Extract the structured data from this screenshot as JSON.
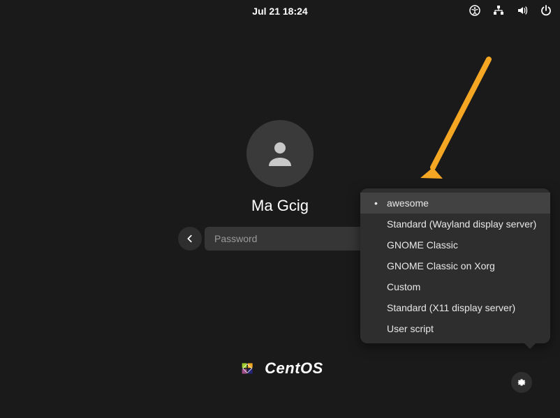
{
  "topbar": {
    "datetime": "Jul 21  18:24"
  },
  "user": {
    "name": "Ma Gcig"
  },
  "password": {
    "placeholder": "Password"
  },
  "branding": {
    "name": "CentOS"
  },
  "session_menu": {
    "items": [
      {
        "label": "awesome",
        "selected": true,
        "highlighted": true
      },
      {
        "label": "Standard (Wayland display server)",
        "selected": false,
        "highlighted": false
      },
      {
        "label": "GNOME Classic",
        "selected": false,
        "highlighted": false
      },
      {
        "label": "GNOME Classic on Xorg",
        "selected": false,
        "highlighted": false
      },
      {
        "label": "Custom",
        "selected": false,
        "highlighted": false
      },
      {
        "label": "Standard (X11 display server)",
        "selected": false,
        "highlighted": false
      },
      {
        "label": "User script",
        "selected": false,
        "highlighted": false
      }
    ]
  }
}
